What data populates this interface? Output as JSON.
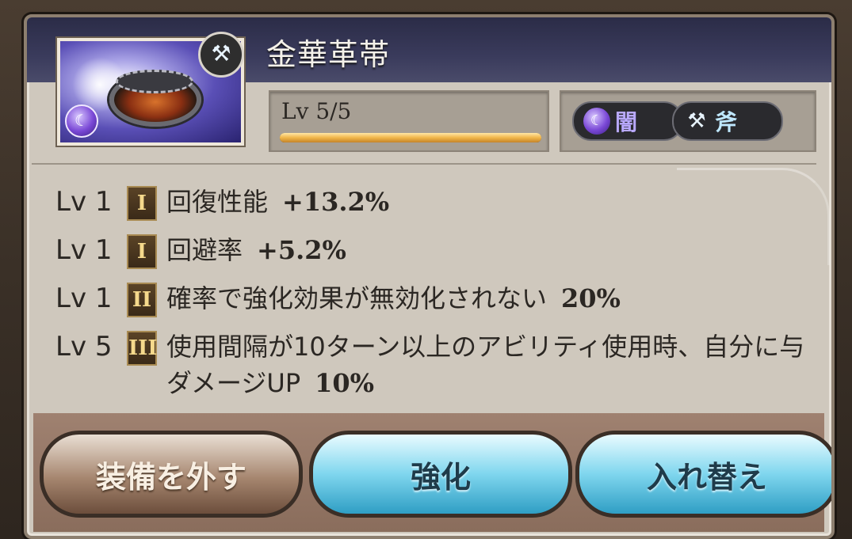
{
  "item": {
    "name": "金華革帯",
    "level_label": "Lv 5/5",
    "level_progress": 1.0,
    "element_tag": "闇",
    "weapon_tag": "斧",
    "element_icon": "dark-element-icon",
    "weapon_icon": "axe-icon"
  },
  "skills": [
    {
      "level": "Lv 1",
      "rank": "I",
      "name": "回復性能",
      "value": "+13.2%"
    },
    {
      "level": "Lv 1",
      "rank": "I",
      "name": "回避率",
      "value": "+5.2%"
    },
    {
      "level": "Lv 1",
      "rank": "II",
      "name": "確率で強化効果が無効化されない",
      "value": "20%"
    },
    {
      "level": "Lv 5",
      "rank": "III",
      "name": "使用間隔が10ターン以上のアビリティ使用時、自分に与ダメージUP",
      "value": "10%"
    }
  ],
  "buttons": {
    "unequip": "装備を外す",
    "upgrade": "強化",
    "swap": "入れ替え"
  },
  "colors": {
    "panel_bg": "#cfc8bd",
    "header_bg": "#2b2c47",
    "level_bar": "#f0b64a",
    "upgrade_button": "#7fd6ee",
    "unequip_button": "#a6866f"
  }
}
